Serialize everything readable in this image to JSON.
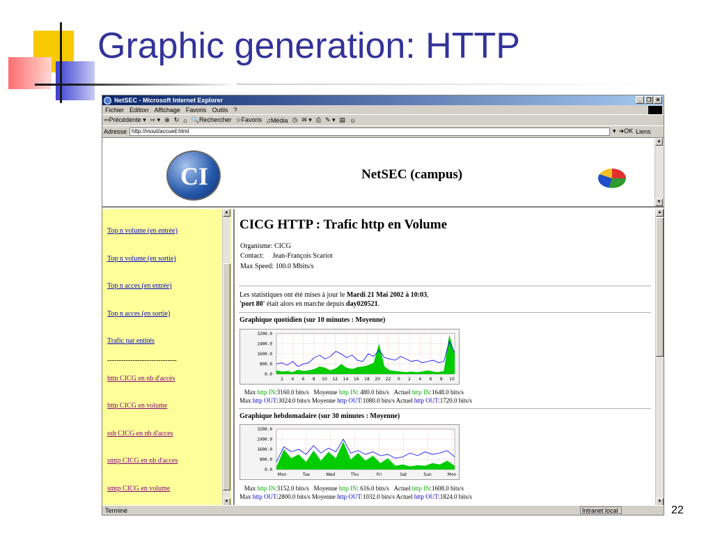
{
  "slide": {
    "title": "Graphic generation: HTTP",
    "page_number": "22"
  },
  "browser": {
    "window_title": "NetSEC - Microsoft Internet Explorer",
    "menu": [
      "Fichier",
      "Edition",
      "Affichage",
      "Favoris",
      "Outils",
      "?"
    ],
    "toolbar": {
      "back": "Précédente",
      "search": "Rechercher",
      "favorites": "Favoris",
      "media": "Média"
    },
    "address_label": "Adresse",
    "address_value": "http://mout/accueil.html",
    "go_label": "OK",
    "links_label": "Liens",
    "status_text": "Terminé",
    "zone_text": "Intranet local"
  },
  "top_frame": {
    "title": "NetSEC (campus)"
  },
  "nav": {
    "items": [
      {
        "label": "Top n volume (en entrée)",
        "visited": false
      },
      {
        "label": "Top n volume (en sortie)",
        "visited": false
      },
      {
        "label": "Top n acces (en entrée)",
        "visited": false
      },
      {
        "label": "Top n acces (en sortie)",
        "visited": false
      },
      {
        "label": "Trafic par entités",
        "visited": false
      },
      {
        "label": "------------------------------",
        "separator": true
      },
      {
        "label": "http CICG en nb d'accès",
        "visited": true
      },
      {
        "label": "http CICG en volume",
        "visited": true
      },
      {
        "label": "ssh CICG en nb d'acces",
        "visited": true
      },
      {
        "label": "smtp CICG en nb d'acces",
        "visited": true
      },
      {
        "label": "smtp CICG en volume",
        "visited": true
      }
    ]
  },
  "main": {
    "heading": "CICG HTTP : Trafic http en Volume",
    "organisme_label": "Organisme:",
    "organisme": "CICG",
    "contact_label": "Contact:",
    "contact": "Jean-François Scariot",
    "maxspeed_label": "Max Speed:",
    "maxspeed": "100.0 Mbits/s",
    "update_prefix": "Les statistiques ont été mises à jour le ",
    "update_date": "Mardi 21 Mai 2002 à 10:03",
    "update_suffix": ",",
    "port": "'port 80'",
    "running_text": " était alors en marche depuis ",
    "running_since": "day020521",
    "daily_title": "Graphique quotidien (sur 10 minutes : Moyenne)",
    "weekly_title": "Graphique hebdomadaire (sur 30 minutes : Moyenne)",
    "daily_stats": {
      "in": {
        "max": ":3160.0 bits/s",
        "avg": ": 480.0 bits/s",
        "cur": ":1648.0 bits/s"
      },
      "out": {
        "max": ":3024.0 bits/s",
        "avg": ":1080.0 bits/s",
        "cur": ":1720.0 bits/s"
      }
    },
    "weekly_stats": {
      "in": {
        "max": ":3152.0 bits/s",
        "avg": ": 616.0 bits/s",
        "cur": ":1608.0 bits/s"
      },
      "out": {
        "max": ":2800.0 bits/s",
        "avg": ":1032.0 bits/s",
        "cur": ":1824.0 bits/s"
      }
    },
    "labels": {
      "max": "Max",
      "moyenne": "Moyenne",
      "actuel": "Actuel",
      "http_in": "http IN",
      "http_out": "http OUT"
    }
  },
  "chart_data": [
    {
      "type": "area",
      "title": "Graphique quotidien (sur 10 minutes : Moyenne)",
      "yticks": [
        "3200.0",
        "2400.0",
        "1600.0",
        "800.0",
        "0.0"
      ],
      "ylim": [
        0,
        3200
      ],
      "categories": [
        "2",
        "4",
        "6",
        "8",
        "10",
        "12",
        "14",
        "16",
        "18",
        "20",
        "22",
        "0",
        "2",
        "4",
        "6",
        "8",
        "10"
      ],
      "series": [
        {
          "name": "http IN",
          "color": "#00cc00",
          "values": [
            300,
            200,
            250,
            150,
            350,
            250,
            300,
            400,
            600,
            500,
            300,
            450,
            800,
            500,
            400,
            550,
            600,
            700,
            900,
            2400,
            600,
            300,
            250,
            200,
            150,
            200,
            150,
            200,
            300,
            200,
            150,
            250,
            3100,
            1600
          ]
        },
        {
          "name": "http OUT",
          "color": "#0000ff",
          "values": [
            800,
            900,
            700,
            1000,
            600,
            800,
            900,
            1300,
            1500,
            1200,
            1400,
            1800,
            1600,
            1300,
            1500,
            1100,
            1000,
            1600,
            1400,
            1900,
            1300,
            1200,
            1100,
            1400,
            1200,
            1000,
            1100,
            900,
            1000,
            1100,
            900,
            1000,
            2600,
            1700
          ]
        }
      ]
    },
    {
      "type": "area",
      "title": "Graphique hebdomadaire (sur 30 minutes : Moyenne)",
      "yticks": [
        "3200.0",
        "2400.0",
        "1600.0",
        "800.0",
        "0.0"
      ],
      "ylim": [
        0,
        3200
      ],
      "categories": [
        "Mon",
        "Tue",
        "Wed",
        "Thu",
        "Fri",
        "Sat",
        "Sun",
        "Mon"
      ],
      "series": [
        {
          "name": "http IN",
          "color": "#00cc00",
          "values": [
            200,
            1600,
            900,
            1200,
            600,
            1500,
            700,
            1400,
            900,
            2200,
            800,
            1300,
            700,
            1100,
            500,
            900,
            300,
            400,
            250,
            350,
            300,
            500,
            400,
            700,
            300
          ]
        },
        {
          "name": "http OUT",
          "color": "#0000ff",
          "values": [
            600,
            1800,
            1400,
            1600,
            1200,
            1900,
            1300,
            1700,
            1400,
            2400,
            1300,
            1500,
            1200,
            1400,
            1100,
            1200,
            900,
            1000,
            1300,
            1100,
            1400,
            1200,
            1300,
            1500,
            1000
          ]
        }
      ]
    }
  ]
}
